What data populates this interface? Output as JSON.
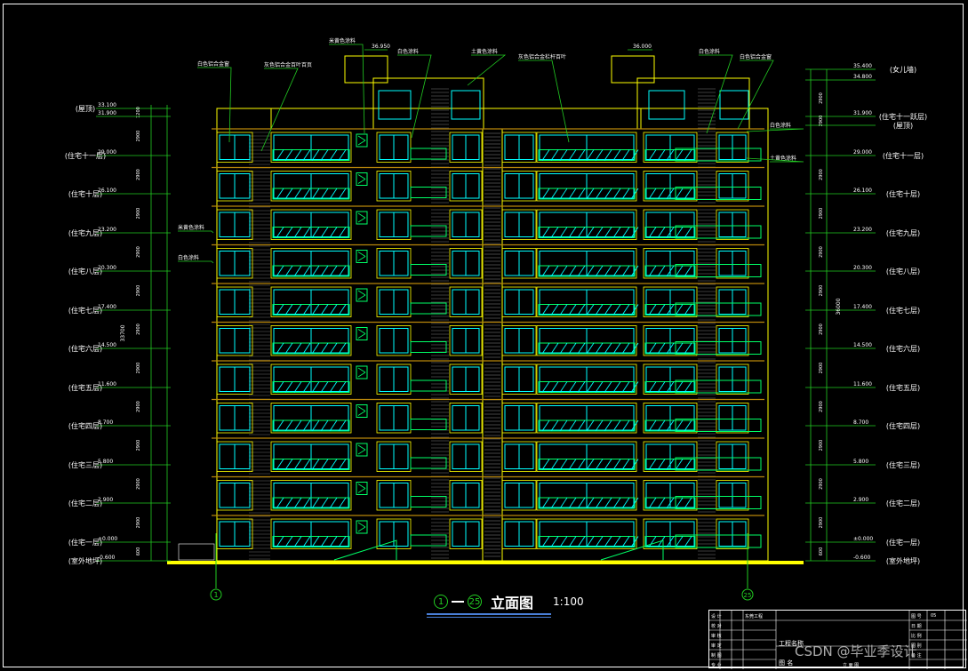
{
  "drawing": {
    "title": "立面图",
    "axis_start": "1",
    "axis_end": "25",
    "scale": "1:100",
    "ground_label_right": "25"
  },
  "levels_left": [
    {
      "name": "(屋顶)",
      "elev": "33.100",
      "dim": "1200"
    },
    {
      "name": "",
      "elev": "31.900",
      "dim": "2900"
    },
    {
      "name": "(住宅十一层)",
      "elev": "29.000",
      "dim": "2900"
    },
    {
      "name": "(住宅十层)",
      "elev": "26.100",
      "dim": "2900"
    },
    {
      "name": "(住宅九层)",
      "elev": "23.200",
      "dim": "2900"
    },
    {
      "name": "(住宅八层)",
      "elev": "20.300",
      "dim": "2900"
    },
    {
      "name": "(住宅七层)",
      "elev": "17.400",
      "dim": "2900"
    },
    {
      "name": "(住宅六层)",
      "elev": "14.500",
      "dim": "2900"
    },
    {
      "name": "(住宅五层)",
      "elev": "11.600",
      "dim": "2900"
    },
    {
      "name": "(住宅四层)",
      "elev": "8.700",
      "dim": "2900"
    },
    {
      "name": "(住宅三层)",
      "elev": "5.800",
      "dim": "2900"
    },
    {
      "name": "(住宅二层)",
      "elev": "2.900",
      "dim": "2900"
    },
    {
      "name": "(住宅一层)",
      "elev": "±0.000",
      "dim": "600"
    },
    {
      "name": "(室外地坪)",
      "elev": "-0.600",
      "dim": ""
    }
  ],
  "levels_right": [
    {
      "name": "(女儿墙)",
      "elev": "35.400",
      "dim": ""
    },
    {
      "name": "",
      "elev": "34.800",
      "dim": "2900"
    },
    {
      "name": "(住宅十一跃层)",
      "elev": "31.900",
      "dim": "2900"
    },
    {
      "name": "(屋顶)",
      "elev": "",
      "dim": ""
    },
    {
      "name": "(住宅十一层)",
      "elev": "29.000",
      "dim": "2900"
    },
    {
      "name": "(住宅十层)",
      "elev": "26.100",
      "dim": "2900"
    },
    {
      "name": "(住宅九层)",
      "elev": "23.200",
      "dim": "2900"
    },
    {
      "name": "(住宅八层)",
      "elev": "20.300",
      "dim": "2900"
    },
    {
      "name": "(住宅七层)",
      "elev": "17.400",
      "dim": "2900"
    },
    {
      "name": "(住宅六层)",
      "elev": "14.500",
      "dim": "2900"
    },
    {
      "name": "(住宅五层)",
      "elev": "11.600",
      "dim": "2900"
    },
    {
      "name": "(住宅四层)",
      "elev": "8.700",
      "dim": "2900"
    },
    {
      "name": "(住宅三层)",
      "elev": "5.800",
      "dim": "2900"
    },
    {
      "name": "(住宅二层)",
      "elev": "2.900",
      "dim": "2900"
    },
    {
      "name": "(住宅一层)",
      "elev": "±0.000",
      "dim": "600"
    },
    {
      "name": "(室外地坪)",
      "elev": "-0.600",
      "dim": ""
    }
  ],
  "total_dim_left": "33700",
  "total_dim_right": "36000",
  "callouts": {
    "top_left_1": "白色铝合金窗",
    "top_left_2": "灰色铝合金百叶百页",
    "top_mid_1": "米黄色涂料",
    "top_mid_elev": "36.950",
    "top_mid_2": "白色涂料",
    "top_mid_3": "土黄色涂料",
    "top_mid_4": "灰色铝合金栏杆百叶",
    "top_right_elev": "36.000",
    "top_right_1": "白色涂料",
    "top_right_2": "白色铝合金窗",
    "right_1": "白色涂料",
    "right_2": "土黄色涂料",
    "left_1": "米黄色涂料",
    "left_2": "白色涂料"
  },
  "title_block": {
    "project_label": "工程名称",
    "drawing_label": "图 名",
    "drawing_value": "立 面 图",
    "sheet_no_label": "图 号",
    "sheet_no": "05",
    "rows_left": [
      "设 计",
      "校 对",
      "审 核",
      "审 定",
      "制 图",
      "专 业"
    ],
    "rows_right": [
      "日 期",
      "比 例",
      "图 别",
      "备 注"
    ],
    "company": "东莞工程"
  },
  "watermark": "CSDN @毕业季设计",
  "colors": {
    "background": "#000000",
    "outline": "#ffff00",
    "window": "#00ffff",
    "callout": "#22cc22",
    "railing": "#00ff66",
    "brown": "#b8860b",
    "ground": "#ffff00",
    "text": "#ffffff"
  }
}
